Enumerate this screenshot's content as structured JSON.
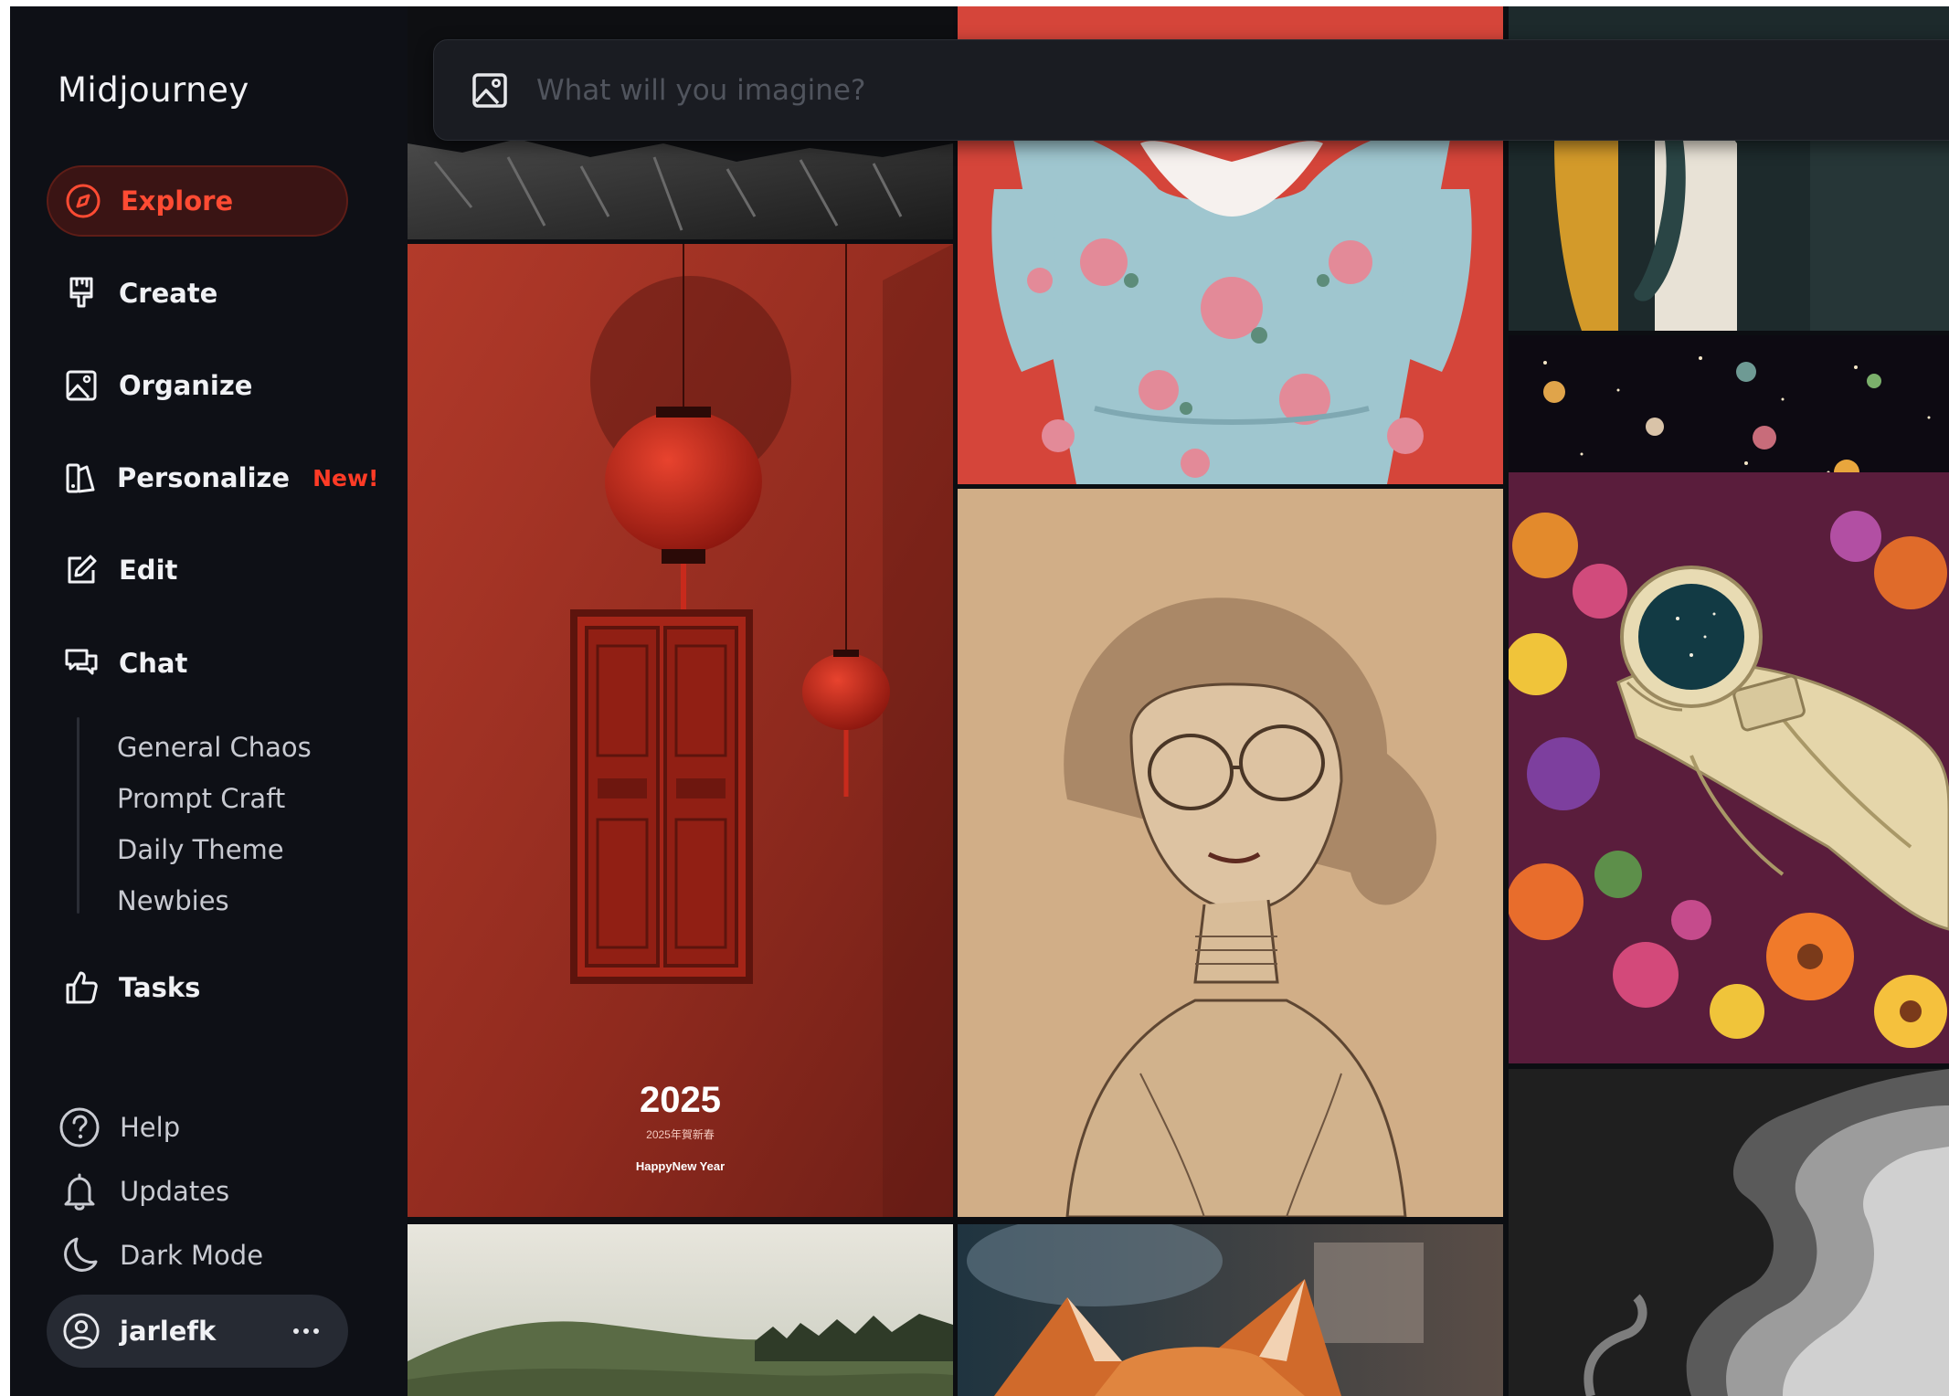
{
  "app": {
    "brand": "Midjourney"
  },
  "nav": {
    "explore": "Explore",
    "create": "Create",
    "organize": "Organize",
    "personalize": "Personalize",
    "personalize_badge": "New!",
    "edit": "Edit",
    "chat": "Chat",
    "chat_channels": [
      "General Chaos",
      "Prompt Craft",
      "Daily Theme",
      "Newbies"
    ],
    "tasks": "Tasks"
  },
  "footer": {
    "help": "Help",
    "updates": "Updates",
    "dark_mode": "Dark Mode",
    "username": "jarlefk"
  },
  "search": {
    "placeholder": "What will you imagine?"
  },
  "gallery": {
    "poster": {
      "year": "2025",
      "subtitle": "2025年賀新春",
      "greeting": "HappyNew Year"
    }
  },
  "colors": {
    "accent": "#ff4b33",
    "sidebar_bg": "#0e1016",
    "active_bg": "#3a1414"
  },
  "icons": {
    "explore": "compass-icon",
    "create": "brush-icon",
    "organize": "image-icon",
    "personalize": "personalize-icon",
    "edit": "edit-icon",
    "chat": "chat-icon",
    "tasks": "thumbs-up-icon",
    "help": "help-icon",
    "updates": "bell-icon",
    "dark_mode": "moon-icon",
    "user": "user-circle-icon",
    "more": "ellipsis-icon",
    "search": "image-icon"
  }
}
